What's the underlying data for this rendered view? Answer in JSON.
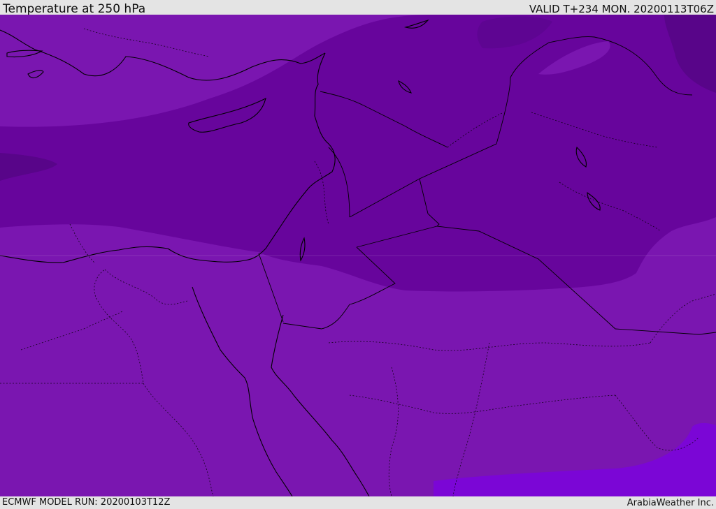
{
  "header": {
    "title": "Temperature at 250 hPa",
    "valid": "VALID T+234 MON. 20200113T06Z"
  },
  "footer": {
    "model_run": "ECMWF MODEL RUN: 20200103T12Z",
    "brand": "ArabiaWeather Inc."
  },
  "colors": {
    "band_warm": "#7a16b0",
    "band_mid": "#67059c",
    "band_cold": "#580589",
    "band_warmest": "#7b06d6",
    "coastline": "#000000",
    "border": "#000000"
  }
}
